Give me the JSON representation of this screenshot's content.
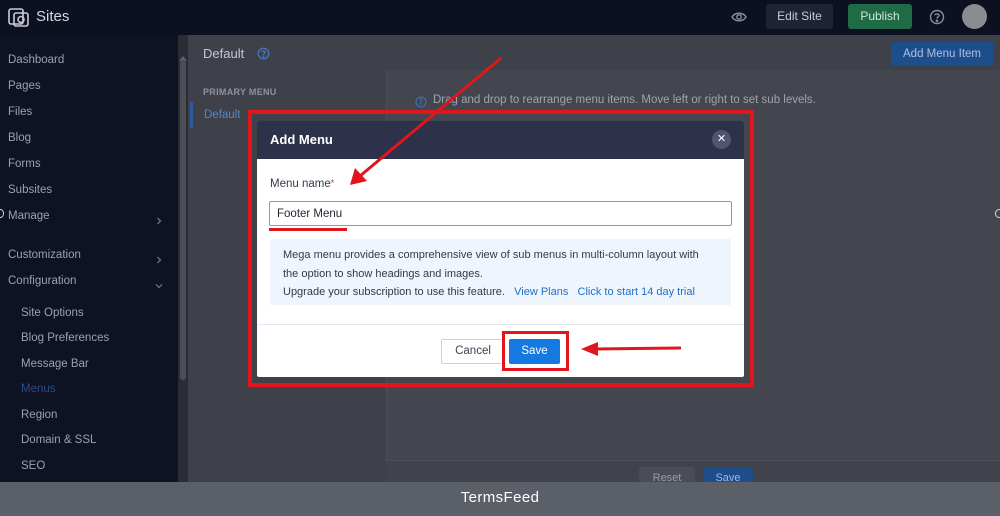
{
  "topbar": {
    "app_title": "Sites",
    "edit_site_label": "Edit Site",
    "publish_label": "Publish"
  },
  "sidebar": {
    "items": [
      {
        "label": "Dashboard"
      },
      {
        "label": "Pages"
      },
      {
        "label": "Files"
      },
      {
        "label": "Blog"
      },
      {
        "label": "Forms"
      },
      {
        "label": "Subsites"
      },
      {
        "label": "Manage"
      },
      {
        "label": "Customization"
      },
      {
        "label": "Configuration"
      }
    ],
    "config_items": [
      {
        "label": "Site Options"
      },
      {
        "label": "Blog Preferences"
      },
      {
        "label": "Message Bar"
      },
      {
        "label": "Menus"
      },
      {
        "label": "Region"
      },
      {
        "label": "Domain & SSL"
      },
      {
        "label": "SEO"
      }
    ]
  },
  "main": {
    "heading": "Default",
    "add_menu_item_label": "Add Menu Item",
    "primary_menu_label": "PRIMARY MENU",
    "menu_default": "Default",
    "drag_hint": "Drag and drop to rearrange menu items. Move left or right to set sub levels.",
    "reset_label": "Reset",
    "save_label": "Save"
  },
  "modal": {
    "title": "Add Menu",
    "field_label": "Menu name",
    "required_mark": "*",
    "input_value": "Footer Menu",
    "mega_line1": "Mega menu provides a comprehensive view of sub menus in multi-column layout with",
    "mega_line2": "the option to show headings and images.",
    "mega_line3": "Upgrade your subscription to use this feature.",
    "view_plans": "View Plans",
    "trial_link": "Click to start 14 day trial",
    "cancel_label": "Cancel",
    "save_label": "Save"
  },
  "annotation_color": "#e0161c",
  "watermark": "TermsFeed"
}
